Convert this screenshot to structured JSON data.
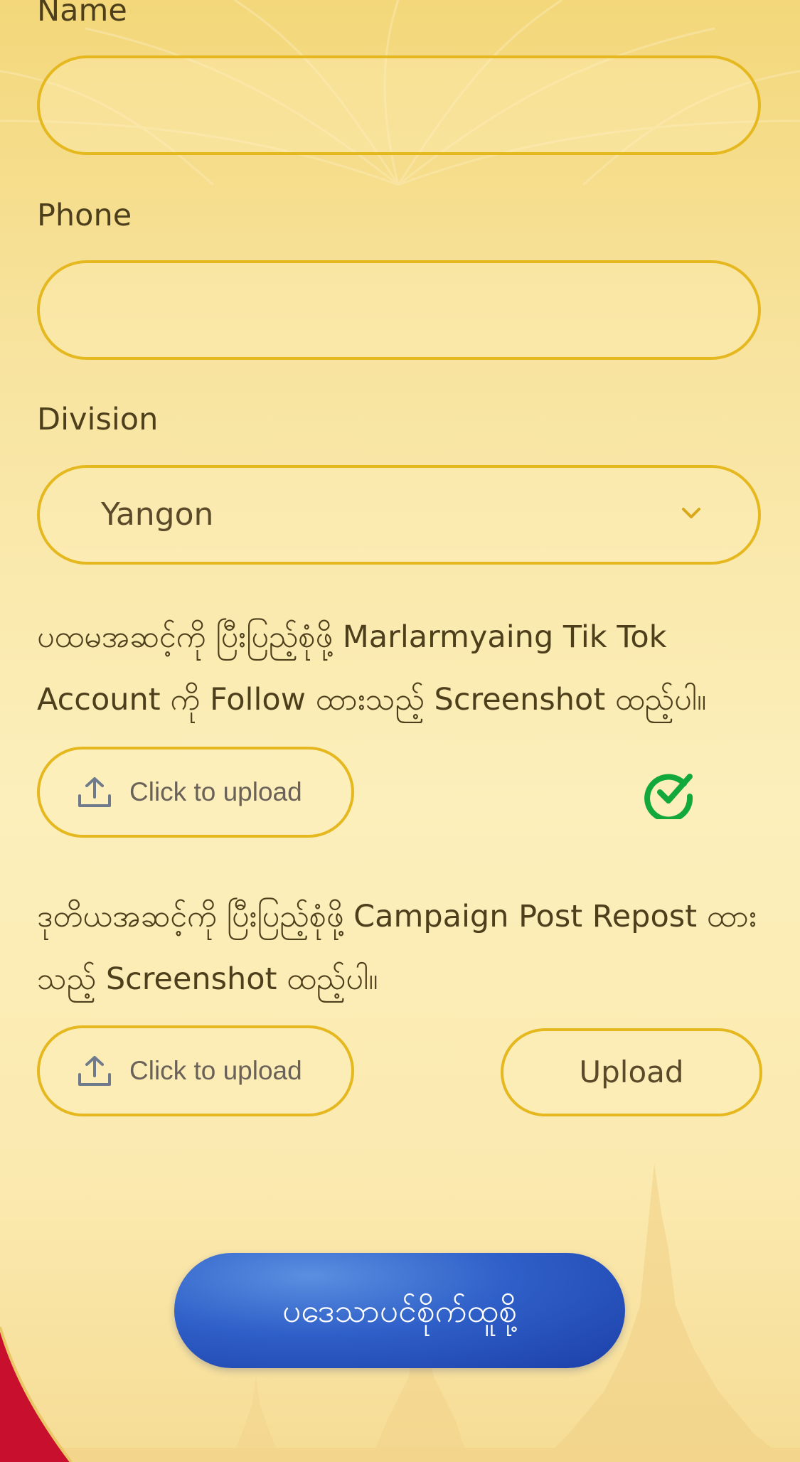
{
  "form": {
    "name_label": "Name",
    "name_value": "",
    "phone_label": "Phone",
    "phone_value": "",
    "division_label": "Division",
    "division_value": "Yangon",
    "step1_instruction": "ပထမအဆင့်ကို ပြီးပြည့်စုံဖို့ Marlarmyaing Tik Tok Account ကို Follow ထားသည့် Screenshot ထည့်ပါ။",
    "step1_upload_label": "Click to upload",
    "step1_status": "uploaded",
    "step2_instruction": "ဒုတိယအဆင့်ကို ပြီးပြည့်စုံဖို့ Campaign Post Repost ထားသည့် Screenshot ထည့်ပါ။",
    "step2_upload_label": "Click to upload",
    "step2_upload_button": "Upload",
    "submit_label": "ပဒေသာပင်စိုက်ထူစို့"
  },
  "icons": {
    "upload": "upload-icon",
    "check": "check-circle-icon",
    "chevron": "chevron-down-icon"
  },
  "colors": {
    "field_border": "#e6b820",
    "check_green": "#12a83a",
    "submit_blue": "#2f5fc8",
    "background": "#fbeab0",
    "accent_red": "#c8102e"
  }
}
